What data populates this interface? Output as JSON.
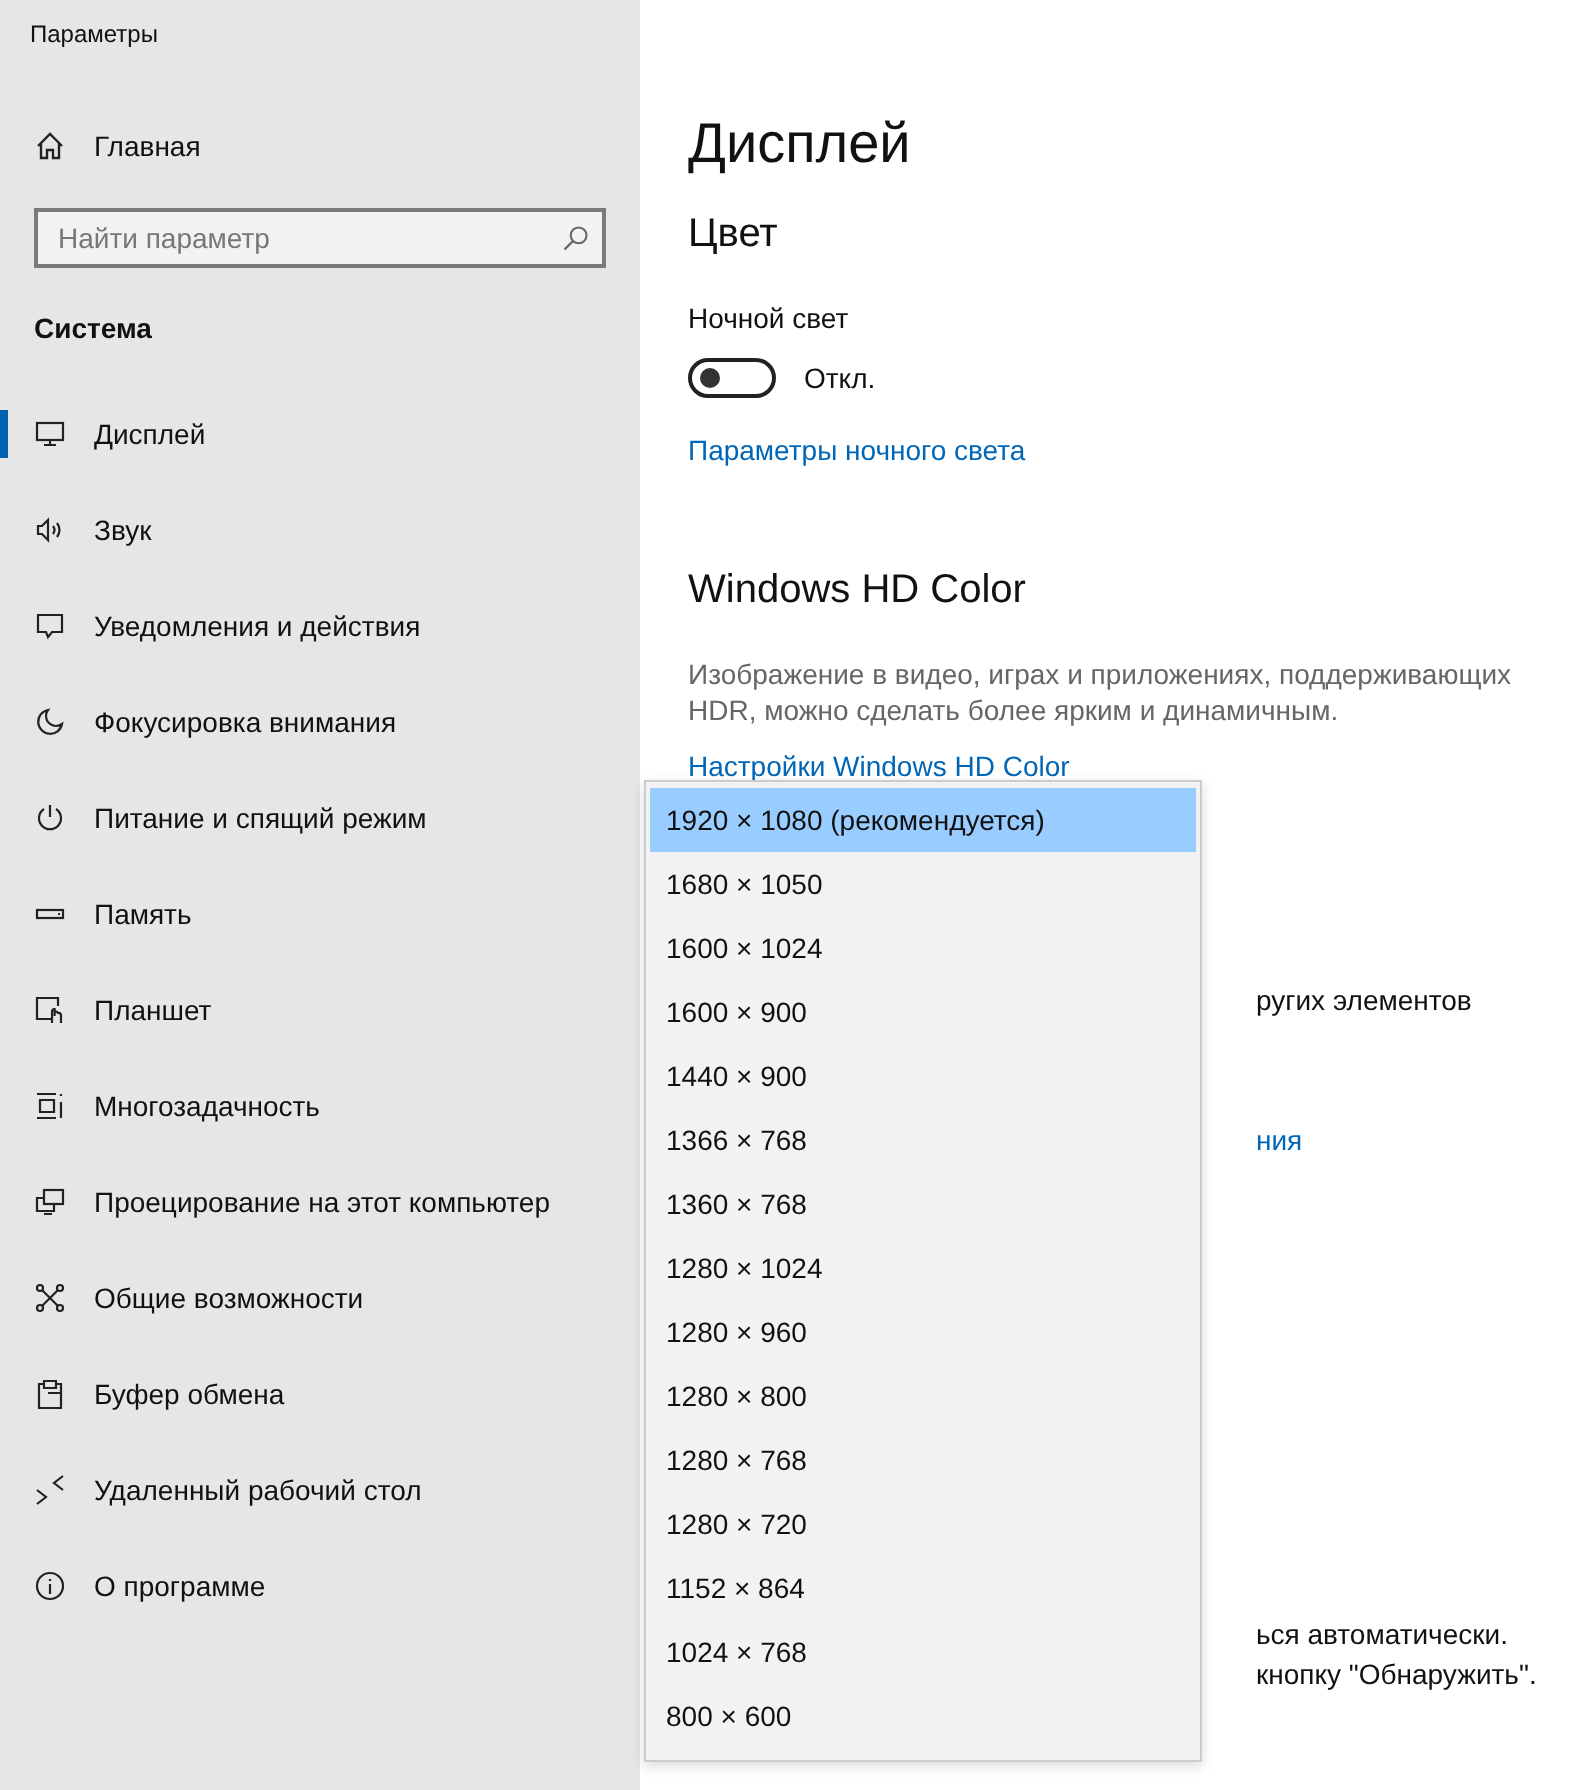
{
  "window": {
    "title": "Параметры"
  },
  "sidebar": {
    "home": "Главная",
    "search": {
      "placeholder": "Найти параметр"
    },
    "section": "Система",
    "items": [
      {
        "label": "Дисплей",
        "selected": true
      },
      {
        "label": "Звук",
        "selected": false
      },
      {
        "label": "Уведомления и действия",
        "selected": false
      },
      {
        "label": "Фокусировка внимания",
        "selected": false
      },
      {
        "label": "Питание и спящий режим",
        "selected": false
      },
      {
        "label": "Память",
        "selected": false
      },
      {
        "label": "Планшет",
        "selected": false
      },
      {
        "label": "Многозадачность",
        "selected": false
      },
      {
        "label": "Проецирование на этот компьютер",
        "selected": false
      },
      {
        "label": "Общие возможности",
        "selected": false
      },
      {
        "label": "Буфер обмена",
        "selected": false
      },
      {
        "label": "Удаленный рабочий стол",
        "selected": false
      },
      {
        "label": "О программе",
        "selected": false
      }
    ]
  },
  "main": {
    "title": "Дисплей",
    "color_heading": "Цвет",
    "night_light": {
      "label": "Ночной свет",
      "on": false,
      "state": "Откл."
    },
    "night_light_link": "Параметры ночного света",
    "hd_heading": "Windows HD Color",
    "hd_text": "Изображение в видео, играх и приложениях, поддерживающих HDR, можно сделать более ярким и динамичным.",
    "hd_link": "Настройки Windows HD Color",
    "partial_texts": [
      {
        "kind": "text",
        "text": "ругих элементов"
      },
      {
        "kind": "link",
        "text": "ния"
      },
      {
        "kind": "text",
        "text": "ься автоматически."
      },
      {
        "kind": "text",
        "text": "кнопку \"Обнаружить\"."
      }
    ]
  },
  "resolution_dropdown": {
    "options": [
      {
        "label": "1920 × 1080 (рекомендуется)",
        "selected": true
      },
      {
        "label": "1680 × 1050",
        "selected": false
      },
      {
        "label": "1600 × 1024",
        "selected": false
      },
      {
        "label": "1600 × 900",
        "selected": false
      },
      {
        "label": "1440 × 900",
        "selected": false
      },
      {
        "label": "1366 × 768",
        "selected": false
      },
      {
        "label": "1360 × 768",
        "selected": false
      },
      {
        "label": "1280 × 1024",
        "selected": false
      },
      {
        "label": "1280 × 960",
        "selected": false
      },
      {
        "label": "1280 × 800",
        "selected": false
      },
      {
        "label": "1280 × 768",
        "selected": false
      },
      {
        "label": "1280 × 720",
        "selected": false
      },
      {
        "label": "1152 × 864",
        "selected": false
      },
      {
        "label": "1024 × 768",
        "selected": false
      },
      {
        "label": "800 × 600",
        "selected": false
      }
    ]
  }
}
